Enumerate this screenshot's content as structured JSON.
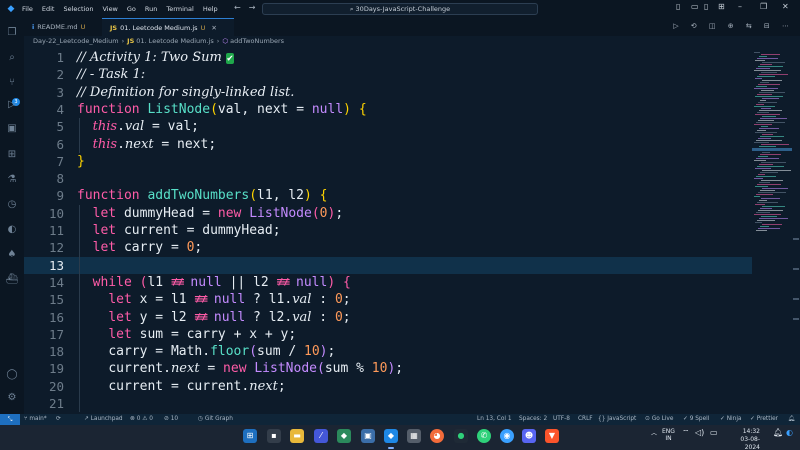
{
  "titlebar": {
    "menu": [
      "File",
      "Edit",
      "Selection",
      "View",
      "Go",
      "Run",
      "Terminal",
      "Help"
    ],
    "search_text": "30Days-JavaScript-Challenge"
  },
  "tabs": [
    {
      "icon": "i",
      "label": "README.md",
      "modified": "U",
      "active": false
    },
    {
      "icon": "JS",
      "label": "01. Leetcode Medium.js",
      "modified": "U",
      "active": true
    }
  ],
  "breadcrumb": [
    "Day-22_Leetcode_Medium",
    "01. Leetcode Medium.js",
    "addTwoNumbers"
  ],
  "editor": {
    "current_line": 13,
    "lines": [
      {
        "n": "1",
        "html": "<span class='cm'>// Activity 1: Two Sum </span><span class='check'>✔</span>"
      },
      {
        "n": "2",
        "html": "<span class='cm'>// - Task 1:</span>"
      },
      {
        "n": "3",
        "html": "<span class='cm'>// Definition for singly-linked list.</span>"
      },
      {
        "n": "4",
        "html": "<span class='kw'>function</span> <span class='fn'>ListNode</span><span class='brk'>(</span><span class='var'>val</span><span class='pun'>, </span><span class='var'>next</span> <span class='op'>=</span> <span class='nl'>null</span><span class='brk'>)</span> <span class='brk'>{</span>"
      },
      {
        "n": "5",
        "html": "  <span class='this'>this</span><span class='pun'>.</span><span class='prop'>val</span> <span class='op'>=</span> <span class='var'>val</span><span class='pun'>;</span>"
      },
      {
        "n": "6",
        "html": "  <span class='this'>this</span><span class='pun'>.</span><span class='prop'>next</span> <span class='op'>=</span> <span class='var'>next</span><span class='pun'>;</span>"
      },
      {
        "n": "7",
        "html": "<span class='brk'>}</span>"
      },
      {
        "n": "8",
        "html": ""
      },
      {
        "n": "9",
        "html": "<span class='kw'>function</span> <span class='fn'>addTwoNumbers</span><span class='brk'>(</span><span class='var'>l1</span><span class='pun'>, </span><span class='var'>l2</span><span class='brk'>)</span> <span class='brk'>{</span>"
      },
      {
        "n": "10",
        "html": "  <span class='kw'>let</span> <span class='var'>dummyHead</span> <span class='op'>=</span> <span class='kw'>new</span> <span class='cls'>ListNode</span><span class='kw'>(</span><span class='num'>0</span><span class='kw'>)</span><span class='pun'>;</span>"
      },
      {
        "n": "11",
        "html": "  <span class='kw'>let</span> <span class='var'>current</span> <span class='op'>=</span> <span class='var'>dummyHead</span><span class='pun'>;</span>"
      },
      {
        "n": "12",
        "html": "  <span class='kw'>let</span> <span class='var'>carry</span> <span class='op'>=</span> <span class='num'>0</span><span class='pun'>;</span>"
      },
      {
        "n": "13",
        "html": ""
      },
      {
        "n": "14",
        "html": "  <span class='kw'>while</span> <span class='kw'>(</span><span class='var'>l1</span> <span class='ne'>≢≢</span> <span class='nl'>null</span> <span class='op'>||</span> <span class='var'>l2</span> <span class='ne'>≢≢</span> <span class='nl'>null</span><span class='kw'>)</span> <span class='kw'>{</span>"
      },
      {
        "n": "15",
        "html": "    <span class='kw'>let</span> <span class='var'>x</span> <span class='op'>=</span> <span class='var'>l1</span> <span class='ne'>≢≢</span> <span class='nl'>null</span> <span class='op'>?</span> <span class='var'>l1</span><span class='pun'>.</span><span class='prop'>val</span> <span class='op'>:</span> <span class='num'>0</span><span class='pun'>;</span>"
      },
      {
        "n": "16",
        "html": "    <span class='kw'>let</span> <span class='var'>y</span> <span class='op'>=</span> <span class='var'>l2</span> <span class='ne'>≢≢</span> <span class='nl'>null</span> <span class='op'>?</span> <span class='var'>l2</span><span class='pun'>.</span><span class='prop'>val</span> <span class='op'>:</span> <span class='num'>0</span><span class='pun'>;</span>"
      },
      {
        "n": "17",
        "html": "    <span class='kw'>let</span> <span class='var'>sum</span> <span class='op'>=</span> <span class='var'>carry</span> <span class='op'>+</span> <span class='var'>x</span> <span class='op'>+</span> <span class='var'>y</span><span class='pun'>;</span>"
      },
      {
        "n": "18",
        "html": "    <span class='var'>carry</span> <span class='op'>=</span> <span class='var'>Math</span><span class='pun'>.</span><span class='fn'>floor</span><span class='cls'>(</span><span class='var'>sum</span> <span class='op'>/</span> <span class='num'>10</span><span class='cls'>)</span><span class='pun'>;</span>"
      },
      {
        "n": "19",
        "html": "    <span class='var'>current</span><span class='pun'>.</span><span class='prop'>next</span> <span class='op'>=</span> <span class='kw'>new</span> <span class='cls'>ListNode</span><span class='cls'>(</span><span class='var'>sum</span> <span class='op'>%</span> <span class='num'>10</span><span class='cls'>)</span><span class='pun'>;</span>"
      },
      {
        "n": "20",
        "html": "    <span class='var'>current</span> <span class='op'>=</span> <span class='var'>current</span><span class='pun'>.</span><span class='prop'>next</span><span class='pun'>;</span>"
      },
      {
        "n": "21",
        "html": ""
      }
    ]
  },
  "statusbar": {
    "branch": "main*",
    "launchpad": "Launchpad",
    "problems": "0 ⚠ 0",
    "ports": "10",
    "git_graph": "Git Graph",
    "position": "Ln 13, Col 1",
    "spaces": "Spaces: 2",
    "encoding": "UTF-8",
    "eol": "CRLF",
    "language": "JavaScript",
    "go_live": "Go Live",
    "spell": "9 Spell",
    "ninja": "Ninja",
    "prettier": "Prettier"
  },
  "taskbar": {
    "lang": "ENG",
    "region": "IN",
    "time": "14:32",
    "date": "03-08-2024"
  },
  "colors": {
    "accent": "#2d7fd3",
    "editor_bg": "#0d1b2a",
    "keyword": "#ff5ca8",
    "function": "#58e0c8"
  }
}
